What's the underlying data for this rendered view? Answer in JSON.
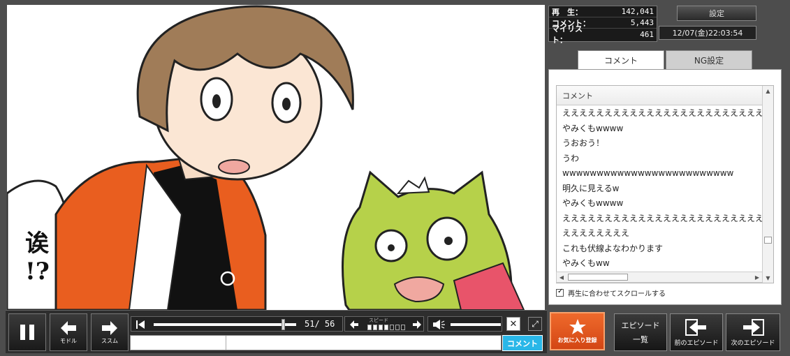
{
  "stats": {
    "views_label": "再　生：",
    "views": "142,041",
    "comments_label": "コメント：",
    "comments": "5,443",
    "mylist_label": "マイリスト：",
    "mylist": "461"
  },
  "settings_label": "設定",
  "datetime": "12/07(金)22:03:54",
  "tabs": {
    "comment": "コメント",
    "ng": "NG設定"
  },
  "comment_panel": {
    "header": "コメント",
    "items": [
      "えええええええええええええええええええええええええ",
      "やみくもwwww",
      "うおおう！",
      "うわ",
      "wwwwwwwwwwwwwwwwwwwwwwwww",
      "明久に見えるw",
      "やみくもwwww",
      "ええええええええええええええええええええええええ",
      "ええええええええ",
      "これも伏線よなわかります",
      "やみくもww"
    ],
    "autoscroll_label": "再生に合わせてスクロールする",
    "autoscroll_checked": true
  },
  "video": {
    "speech_text": "诶\n!?",
    "speech_line1": "诶",
    "speech_line2": "!?"
  },
  "controls": {
    "back_label": "モドル",
    "fwd_label": "ススム",
    "page_counter": "51/ 56",
    "current_page": 51,
    "total_pages": 56,
    "speed_label": "スピード",
    "speed_level": 4,
    "speed_max": 7,
    "comment_button": "コメント"
  },
  "buttons": {
    "favorite": "お気に入り登録",
    "episode_list_line1": "エピソード",
    "episode_list_line2": "一覧",
    "prev_episode": "前のエピソード",
    "next_episode": "次のエピソード"
  },
  "colors": {
    "accent_orange": "#e35a1e",
    "comment_blue": "#29b7e8",
    "jacket_orange": "#e95e1f",
    "cat_green": "#b6d14a"
  }
}
